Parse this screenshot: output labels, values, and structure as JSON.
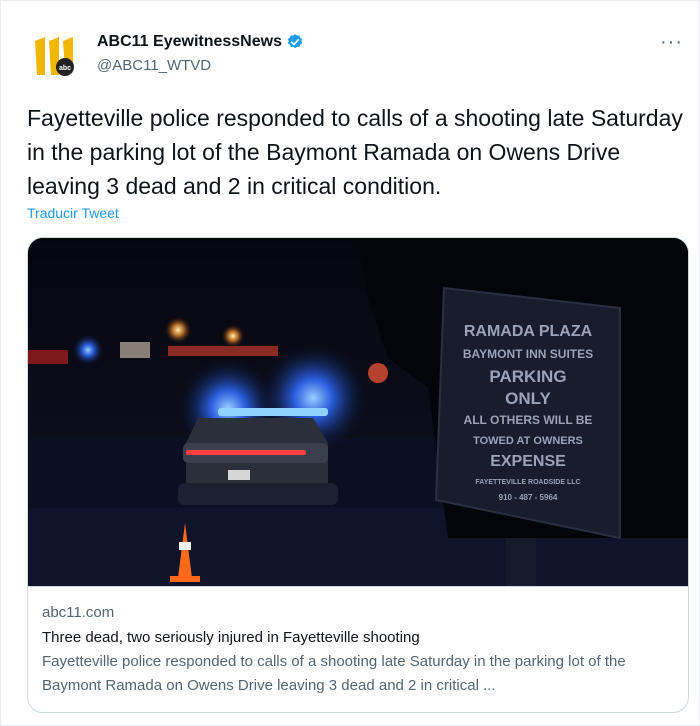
{
  "account": {
    "display_name": "ABC11 EyewitnessNews",
    "handle": "@ABC11_WTVD",
    "avatar_icon": "abc11-logo",
    "verified_icon": "verified-badge-icon",
    "more_label": "···"
  },
  "tweet": {
    "text": "Fayetteville police responded to calls of a shooting late Saturday in the parking lot of the Baymont Ramada on Owens Drive leaving 3 dead and 2 in critical condition.",
    "translate_link": "Traducir Tweet"
  },
  "card": {
    "domain": "abc11.com",
    "title": "Three dead, two seriously injured in Fayetteville shooting",
    "description": "Fayetteville police responded to calls of a shooting late Saturday in the parking lot of the Baymont Ramada on Owens Drive leaving 3 dead and 2 in critical ...",
    "image": {
      "sign_lines": [
        "RAMADA PLAZA",
        "BAYMONT INN SUITES",
        "PARKING",
        "ONLY",
        "ALL OTHERS WILL BE",
        "TOWED AT OWNERS",
        "EXPENSE",
        "FAYETTEVILLE ROADSIDE LLC",
        "910 - 487 - 5964"
      ]
    }
  },
  "colors": {
    "link": "#1d9bf0",
    "secondary_text": "#536471",
    "primary_text": "#0f1419",
    "border": "#cfd9de",
    "logo_yellow": "#f2b705"
  }
}
